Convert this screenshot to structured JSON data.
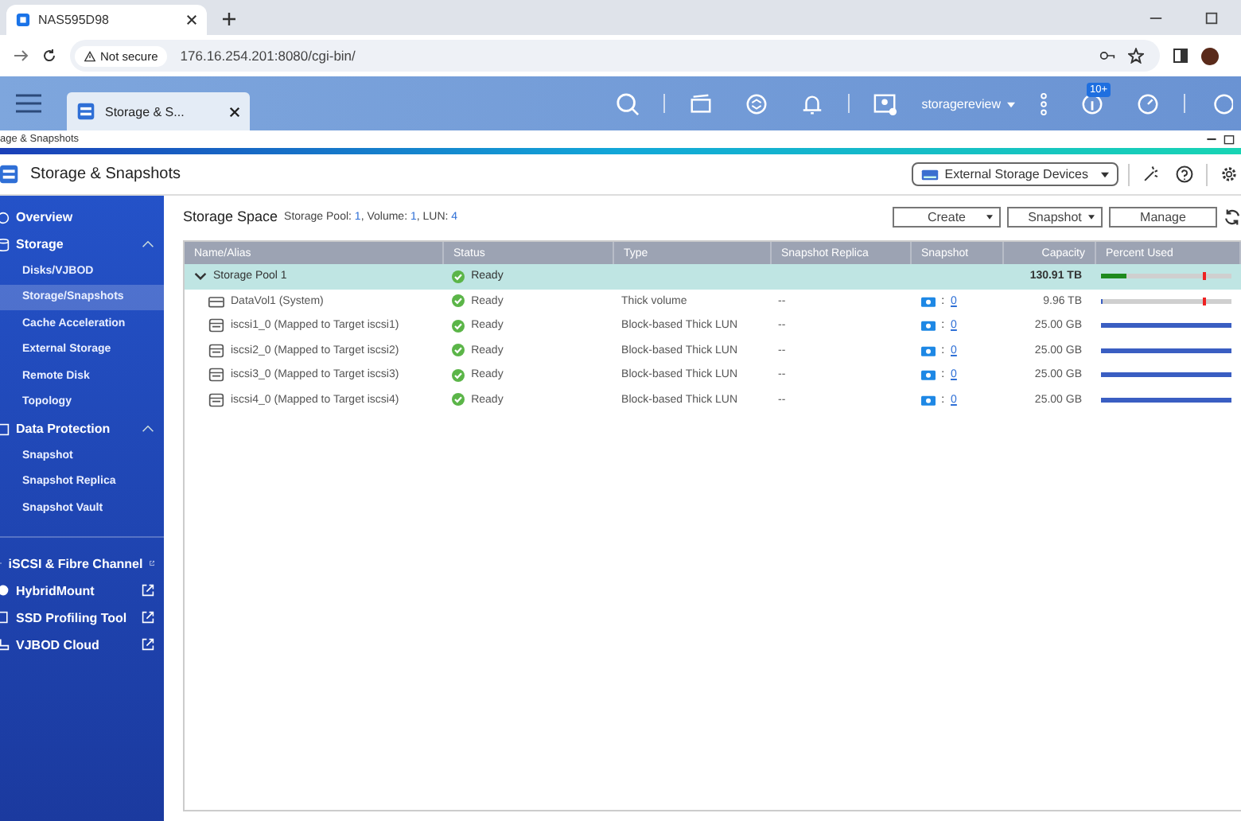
{
  "browser": {
    "tab_title": "NAS595D98",
    "security": "Not secure",
    "url": "176.16.254.201:8080/cgi-bin/"
  },
  "qts_header": {
    "app_tab": "Storage & S...",
    "user": "storagereview",
    "notification_badge": "10+"
  },
  "app_strip": {
    "title": "age & Snapshots"
  },
  "app_header": {
    "title": "Storage & Snapshots",
    "external_button": "External Storage Devices"
  },
  "sidebar": {
    "sections": [
      {
        "label": "Overview"
      },
      {
        "label": "Storage",
        "expanded": true,
        "children": [
          {
            "label": "Disks/VJBOD",
            "selected": false
          },
          {
            "label": "Storage/Snapshots",
            "selected": true
          },
          {
            "label": "Cache Acceleration",
            "selected": false
          },
          {
            "label": "External Storage",
            "selected": false
          },
          {
            "label": "Remote Disk",
            "selected": false
          },
          {
            "label": "Topology",
            "selected": false
          }
        ]
      },
      {
        "label": "Data Protection",
        "expanded": true,
        "children": [
          {
            "label": "Snapshot",
            "selected": false
          },
          {
            "label": "Snapshot Replica",
            "selected": false
          },
          {
            "label": "Snapshot Vault",
            "selected": false
          }
        ]
      }
    ],
    "links": [
      {
        "label": "iSCSI & Fibre Channel"
      },
      {
        "label": "HybridMount"
      },
      {
        "label": "SSD Profiling Tool"
      },
      {
        "label": "VJBOD Cloud"
      }
    ]
  },
  "storage_space": {
    "title": "Storage Space",
    "summary": [
      {
        "label": "Storage Pool:",
        "value": "1"
      },
      {
        "label": ", Volume:",
        "value": "1"
      },
      {
        "label": ", LUN:",
        "value": "4"
      }
    ],
    "buttons": [
      {
        "label": "Create",
        "kind": "dropdown"
      },
      {
        "label": "Snapshot",
        "kind": "dropdown"
      },
      {
        "label": "Manage",
        "kind": "plain"
      }
    ]
  },
  "table": {
    "columns": [
      "Name/Alias",
      "Status",
      "Type",
      "Snapshot Replica",
      "Snapshot",
      "Capacity",
      "Percent Used"
    ],
    "snapshot_separator": ":",
    "rows": [
      {
        "kind": "pool",
        "name": "Storage Pool 1",
        "expanded": true,
        "status": "Ready",
        "type": "",
        "replica": "",
        "snapshot": "",
        "capacity": "130.91 TB",
        "level": 0.2
      },
      {
        "kind": "volume",
        "name": "DataVol1 (System)",
        "status": "Ready",
        "type": "Thick volume",
        "replica": "--",
        "snapshot": "0",
        "capacity": "9.96 TB",
        "level": 0.01
      },
      {
        "kind": "lun",
        "name": "iscsi1_0 (Mapped to Target iscsi1)",
        "status": "Ready",
        "type": "Block-based Thick LUN",
        "replica": "--",
        "snapshot": "0",
        "capacity": "25.00 GB",
        "level": 1
      },
      {
        "kind": "lun",
        "name": "iscsi2_0 (Mapped to Target iscsi2)",
        "status": "Ready",
        "type": "Block-based Thick LUN",
        "replica": "--",
        "snapshot": "0",
        "capacity": "25.00 GB",
        "level": 1
      },
      {
        "kind": "lun",
        "name": "iscsi3_0 (Mapped to Target iscsi3)",
        "status": "Ready",
        "type": "Block-based Thick LUN",
        "replica": "--",
        "snapshot": "0",
        "capacity": "25.00 GB",
        "level": 1
      },
      {
        "kind": "lun",
        "name": "iscsi4_0 (Mapped to Target iscsi4)",
        "status": "Ready",
        "type": "Block-based Thick LUN",
        "replica": "--",
        "snapshot": "0",
        "capacity": "25.00 GB",
        "level": 1
      }
    ]
  }
}
